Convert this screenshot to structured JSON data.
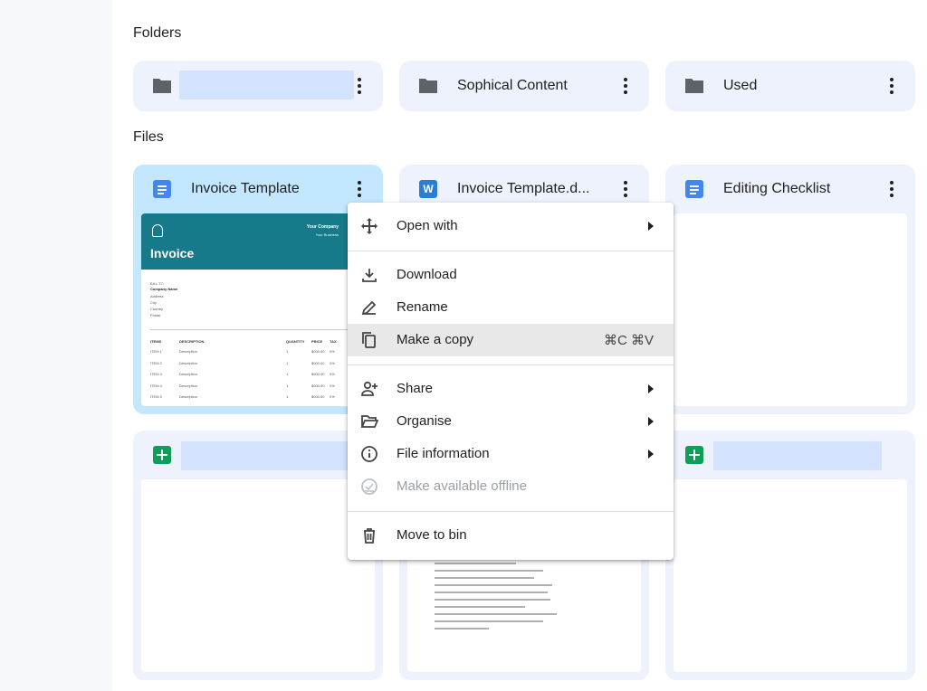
{
  "sections": {
    "folders_label": "Folders",
    "files_label": "Files"
  },
  "folders": [
    {
      "name": ""
    },
    {
      "name": "Sophical Content"
    },
    {
      "name": "Used"
    }
  ],
  "files": [
    {
      "title": "Invoice Template",
      "icon": "google-docs-icon"
    },
    {
      "title": "Invoice Template.d...",
      "icon": "word-icon",
      "icon_letter": "W"
    },
    {
      "title": "Editing Checklist",
      "icon": "google-docs-icon"
    },
    {
      "title": "",
      "icon": "google-sheets-icon"
    },
    {
      "title": "",
      "icon": "google-sheets-icon"
    }
  ],
  "invoice_preview": {
    "title": "Invoice",
    "company": "Your Company",
    "company_sub": "Your Business",
    "bill_to": "BILL TO",
    "company_name": "Company Name",
    "address_lines": [
      "Address",
      "City",
      "Country",
      "Postal"
    ],
    "columns": [
      "ITEMS",
      "DESCRIPTION",
      "QUANTITY",
      "PRICE",
      "TAX"
    ],
    "rows": [
      [
        "ITEM 1",
        "Description",
        "1",
        "$000.00",
        "0%"
      ],
      [
        "ITEM 2",
        "Description",
        "1",
        "$000.00",
        "0%"
      ],
      [
        "ITEM 3",
        "Description",
        "1",
        "$000.00",
        "0%"
      ],
      [
        "ITEM 4",
        "Description",
        "1",
        "$000.00",
        "0%"
      ],
      [
        "ITEM 5",
        "Description",
        "1",
        "$000.00",
        "0%"
      ]
    ]
  },
  "context_menu": {
    "open_with": "Open with",
    "download": "Download",
    "rename": "Rename",
    "make_copy": "Make a copy",
    "make_copy_shortcut": "⌘C ⌘V",
    "share": "Share",
    "organise": "Organise",
    "file_information": "File information",
    "make_available_offline": "Make available offline",
    "move_to_bin": "Move to bin"
  },
  "colors": {
    "card_bg": "#edf2fc",
    "selected_card_bg": "#c2e7ff",
    "invoice_teal": "#167a8b",
    "docs_blue": "#4285f4",
    "sheets_green": "#0f9d58"
  }
}
